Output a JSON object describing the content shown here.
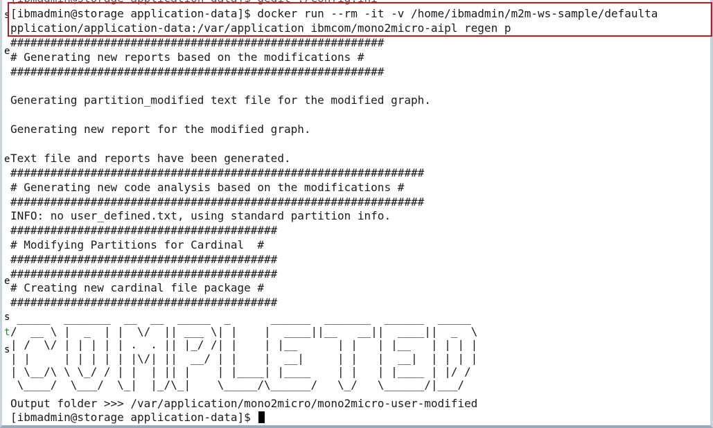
{
  "terminal": {
    "cut_line": "[ibmadmin@storage application-data]$ gedit ./config.ini",
    "command_line_1": "[ibmadmin@storage application-data]$ docker run --rm -it -v /home/ibmadmin/m2m-ws-sample/defaulta",
    "command_line_2": "pplication/application-data:/var/application ibmcom/mono2micro-aipl regen p",
    "hash_56": "########################################################",
    "hash_56b": "########################################################",
    "msg_generating_reports": "# Generating new reports based on the modifications #",
    "msg_partition_modified": "Generating partition_modified text file for the modified graph.",
    "msg_new_report": "Generating new report for the modified graph.",
    "msg_reports_generated": "Text file and reports have been generated.",
    "hash_62": "##############################################################",
    "msg_code_analysis": "# Generating new code analysis based on the modifications #",
    "hash_62b": "##############################################################",
    "msg_info": "INFO: no user_defined.txt, using standard partition info.",
    "hash_40a": "########################################",
    "msg_modifying": "# Modifying Partitions for Cardinal  #",
    "hash_40b": "########################################",
    "hash_40c": "########################################",
    "msg_cardinal": "# Creating new cardinal file package #",
    "hash_40d": "########################################",
    "ascii_art": " _____  _______  __  __  _____  _      ______  _______  ______  _____  \n/  __ \\ |  _  | |  \\/  || ___ \\| |    |  ____||__   __||  ____||  _  \\ \n| /  \\/ | | | | | .  . || |_/ /| |    | |__      | |   | |__   | | | | \n| |     | | | | | |\\/| ||  __/ | |    |  __|     | |   |  __|  | | | | \n| \\__/\\ \\ \\_/ / | |  | || |    | |____| |____    | |   | |____ | |/ /  \n \\____/  \\___/  \\_|  |_/\\_|    \\_____/\\______/   \\_/   \\______/|___/   ",
    "output_folder": "Output folder >>> /var/application/mono2micro/mono2micro-user-modified",
    "final_prompt": "[ibmadmin@storage application-data]$ "
  },
  "gutter": [
    "s",
    "e",
    "e",
    "e",
    "s",
    "t",
    "s"
  ]
}
